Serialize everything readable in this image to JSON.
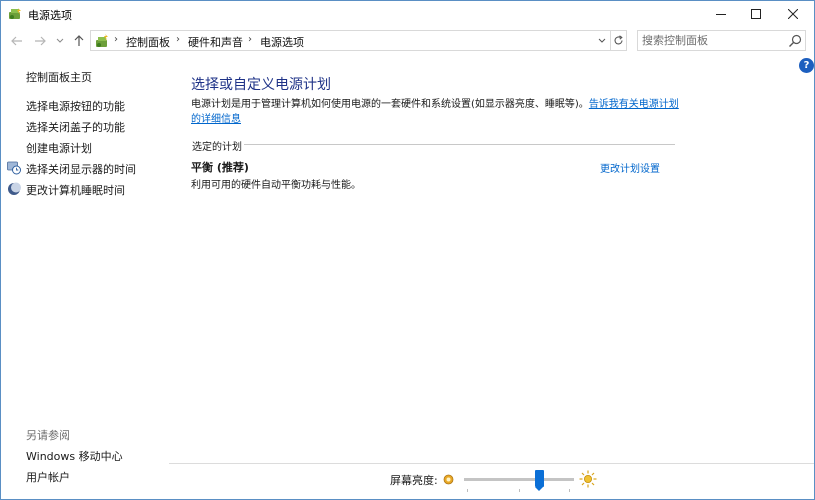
{
  "window": {
    "title": "电源选项",
    "icon": "power-options-icon"
  },
  "nav": {
    "back_icon": "back-arrow-icon",
    "forward_icon": "forward-arrow-icon",
    "recent_icon": "chevron-down-icon",
    "up_icon": "up-arrow-icon",
    "breadcrumbs": [
      "控制面板",
      "硬件和声音",
      "电源选项"
    ],
    "search_placeholder": "搜索控制面板"
  },
  "sidebar": {
    "home": "控制面板主页",
    "items": [
      {
        "label": "选择电源按钮的功能",
        "icon": ""
      },
      {
        "label": "选择关闭盖子的功能",
        "icon": ""
      },
      {
        "label": "创建电源计划",
        "icon": ""
      },
      {
        "label": "选择关闭显示器的时间",
        "icon": "monitor-clock-icon"
      },
      {
        "label": "更改计算机睡眠时间",
        "icon": "moon-icon"
      }
    ],
    "see_also_heading": "另请参阅",
    "see_also": [
      "Windows 移动中心",
      "用户帐户"
    ]
  },
  "main": {
    "title": "选择或自定义电源计划",
    "description": "电源计划是用于管理计算机如何使用电源的一套硬件和系统设置(如显示器亮度、睡眠等)。",
    "description_link": "告诉我有关电源计划的详细信息",
    "section_label": "选定的计划",
    "plan": {
      "name": "平衡 (推荐)",
      "description": "利用可用的硬件自动平衡功耗与性能。",
      "settings_link": "更改计划设置"
    }
  },
  "brightness": {
    "label": "屏幕亮度:",
    "value_percent": 70
  },
  "colors": {
    "link": "#0066cc",
    "title": "#1e3287",
    "slider_thumb": "#0b6fd6"
  }
}
